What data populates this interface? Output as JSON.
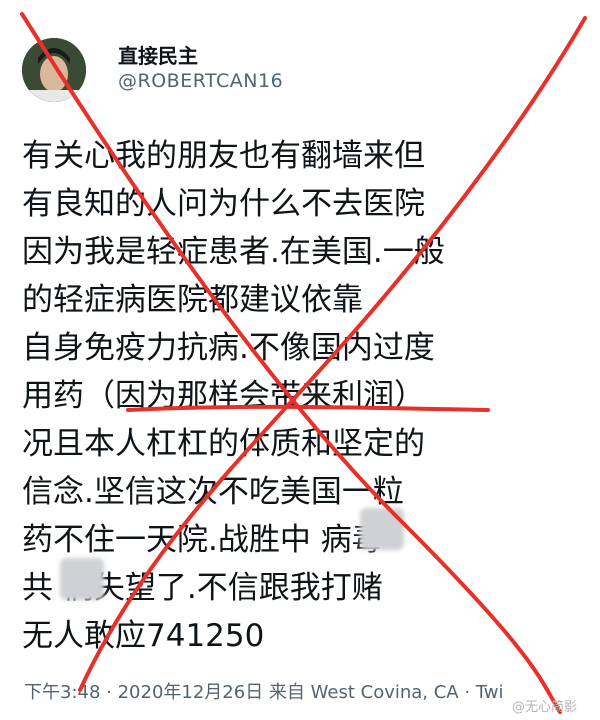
{
  "tweet": {
    "display_name": "直接民主",
    "handle": "@ROBERTCAN16",
    "lines": [
      "有关心我的朋友也有翻墙来但",
      "有良知的人问为什么不去医院",
      "因为我是轻症患者.在美国.一般",
      "的轻症病医院都建议依靠",
      "自身免疫力抗病.不像国内过度",
      "用药（因为那样会带来利润）",
      "况且本人杠杠的体质和坚定的",
      "信念.坚信这次不吃美国一粒",
      "药不住一天院.战胜中  病毒",
      "共  们失望了.不信跟我打赌",
      "无人敢应741250"
    ],
    "meta": "下午3:48 · 2020年12月26日 来自 West Covina, CA · Twi"
  },
  "watermark": "@无心简影",
  "colors": {
    "cross": "#e8302a",
    "underline": "#e8302a",
    "text": "#0f1419",
    "muted": "#536471"
  }
}
